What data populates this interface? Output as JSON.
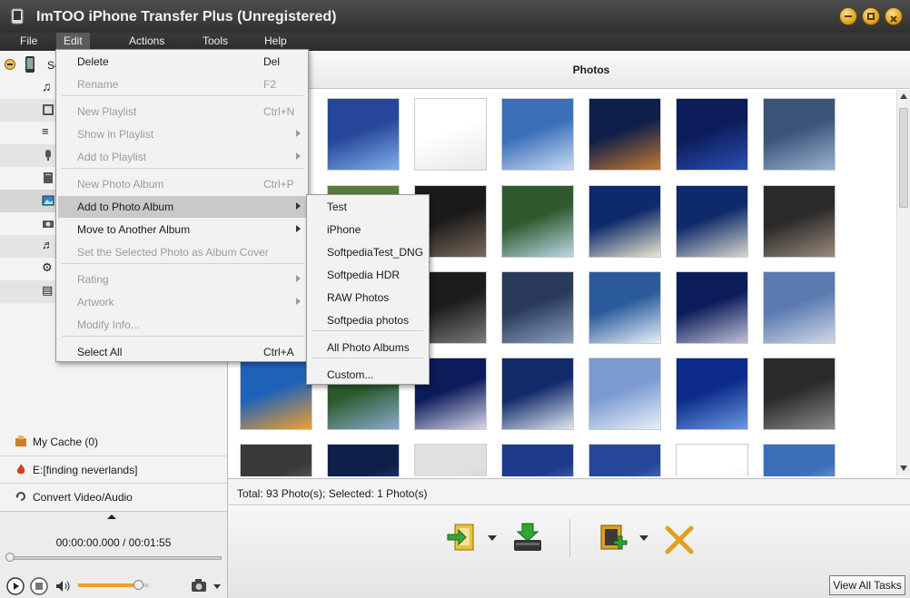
{
  "window": {
    "title": "ImTOO iPhone Transfer Plus (Unregistered)"
  },
  "menubar": [
    "File",
    "Edit",
    "Actions",
    "Tools",
    "Help"
  ],
  "edit_menu": [
    {
      "label": "Delete",
      "shortcut": "Del",
      "enabled": true
    },
    {
      "label": "Rename",
      "shortcut": "F2",
      "enabled": false
    },
    {
      "label": "New Playlist",
      "shortcut": "Ctrl+N",
      "enabled": false
    },
    {
      "label": "Show in Playlist",
      "shortcut": "",
      "enabled": false,
      "submenu": true
    },
    {
      "label": "Add to Playlist",
      "shortcut": "",
      "enabled": false,
      "submenu": true
    },
    {
      "label": "New Photo Album",
      "shortcut": "Ctrl+P",
      "enabled": false
    },
    {
      "label": "Add to Photo Album",
      "shortcut": "",
      "enabled": true,
      "submenu": true,
      "highlighted": true
    },
    {
      "label": "Move to Another Album",
      "shortcut": "",
      "enabled": true,
      "submenu": true
    },
    {
      "label": "Set the Selected Photo as Album Cover",
      "shortcut": "",
      "enabled": false
    },
    {
      "label": "Rating",
      "shortcut": "",
      "enabled": false,
      "submenu": true
    },
    {
      "label": "Artwork",
      "shortcut": "",
      "enabled": false,
      "submenu": true
    },
    {
      "label": "Modify Info...",
      "shortcut": "",
      "enabled": false
    },
    {
      "label": "Select All",
      "shortcut": "Ctrl+A",
      "enabled": true
    }
  ],
  "album_submenu": [
    "Test",
    "iPhone",
    "SoftpediaTest_DNG",
    "Softpedia HDR",
    "RAW Photos",
    "Softpedia photos",
    "All Photo Albums",
    "Custom..."
  ],
  "sidebar": {
    "device_label": "So",
    "cache": "My Cache (0)",
    "burn": "E:[finding neverlands]",
    "convert": "Convert Video/Audio"
  },
  "player": {
    "time": "00:00:00.000 / 00:01:55",
    "volume_level": 0.85
  },
  "main": {
    "header": "Photos",
    "status": "Total: 93 Photo(s); Selected: 1 Photo(s)",
    "view_all": "View All Tasks"
  },
  "colors": {
    "night_blue": "#1d3c8a",
    "dark": "#1a1a1a",
    "water": "#6a8fc8"
  }
}
